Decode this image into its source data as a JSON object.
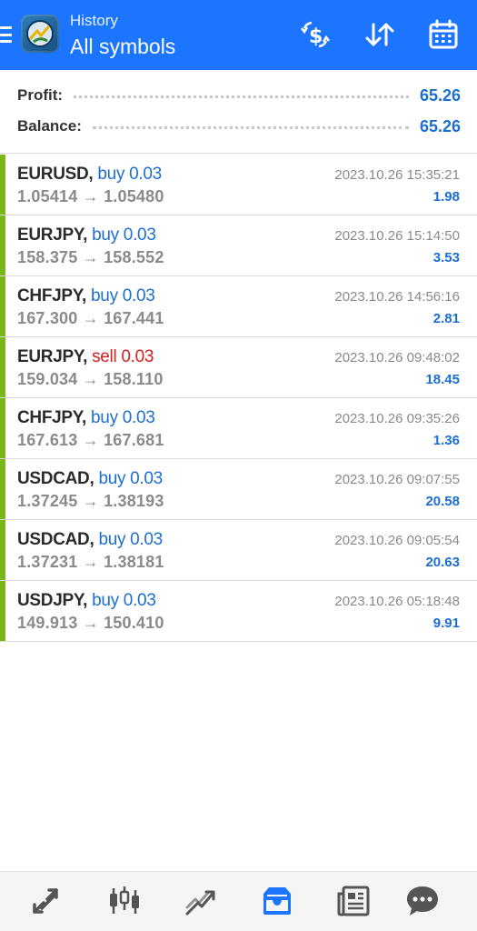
{
  "header": {
    "subtitle": "History",
    "title": "All symbols",
    "icons": [
      "hamburger-menu-icon",
      "metatrader-logo",
      "dollar-exchange-icon",
      "sort-icon",
      "calendar-icon"
    ]
  },
  "summary": {
    "profit_label": "Profit:",
    "profit_value": "65.26",
    "balance_label": "Balance:",
    "balance_value": "65.26"
  },
  "deals": [
    {
      "symbol": "EURUSD,",
      "side": "buy 0.03",
      "prices": "1.05414 → 1.05480",
      "time": "2023.10.26 15:35:21",
      "profit": "1.98"
    },
    {
      "symbol": "EURJPY,",
      "side": "buy 0.03",
      "prices": "158.375 → 158.552",
      "time": "2023.10.26 15:14:50",
      "profit": "3.53"
    },
    {
      "symbol": "CHFJPY,",
      "side": "buy 0.03",
      "prices": "167.300 → 167.441",
      "time": "2023.10.26 14:56:16",
      "profit": "2.81"
    },
    {
      "symbol": "EURJPY,",
      "side": "sell 0.03",
      "prices": "159.034 → 158.110",
      "time": "2023.10.26 09:48:02",
      "profit": "18.45"
    },
    {
      "symbol": "CHFJPY,",
      "side": "buy 0.03",
      "prices": "167.613 → 167.681",
      "time": "2023.10.26 09:35:26",
      "profit": "1.36"
    },
    {
      "symbol": "USDCAD,",
      "side": "buy 0.03",
      "prices": "1.37245 → 1.38193",
      "time": "2023.10.26 09:07:55",
      "profit": "20.58"
    },
    {
      "symbol": "USDCAD,",
      "side": "buy 0.03",
      "prices": "1.37231 → 1.38181",
      "time": "2023.10.26 09:05:54",
      "profit": "20.63"
    },
    {
      "symbol": "USDJPY,",
      "side": "buy 0.03",
      "prices": "149.913 → 150.410",
      "time": "2023.10.26 05:18:48",
      "profit": "9.91"
    }
  ],
  "bottom_nav": {
    "items": [
      "quotes-icon",
      "chart-candles-icon",
      "trade-icon",
      "history-inbox-icon",
      "news-icon",
      "chat-icon"
    ],
    "active": "history-inbox-icon"
  },
  "colors": {
    "accent": "#1b75ff",
    "buy": "#1b6fd1",
    "sell": "#d32020",
    "profit_bar": "#7cb518"
  }
}
